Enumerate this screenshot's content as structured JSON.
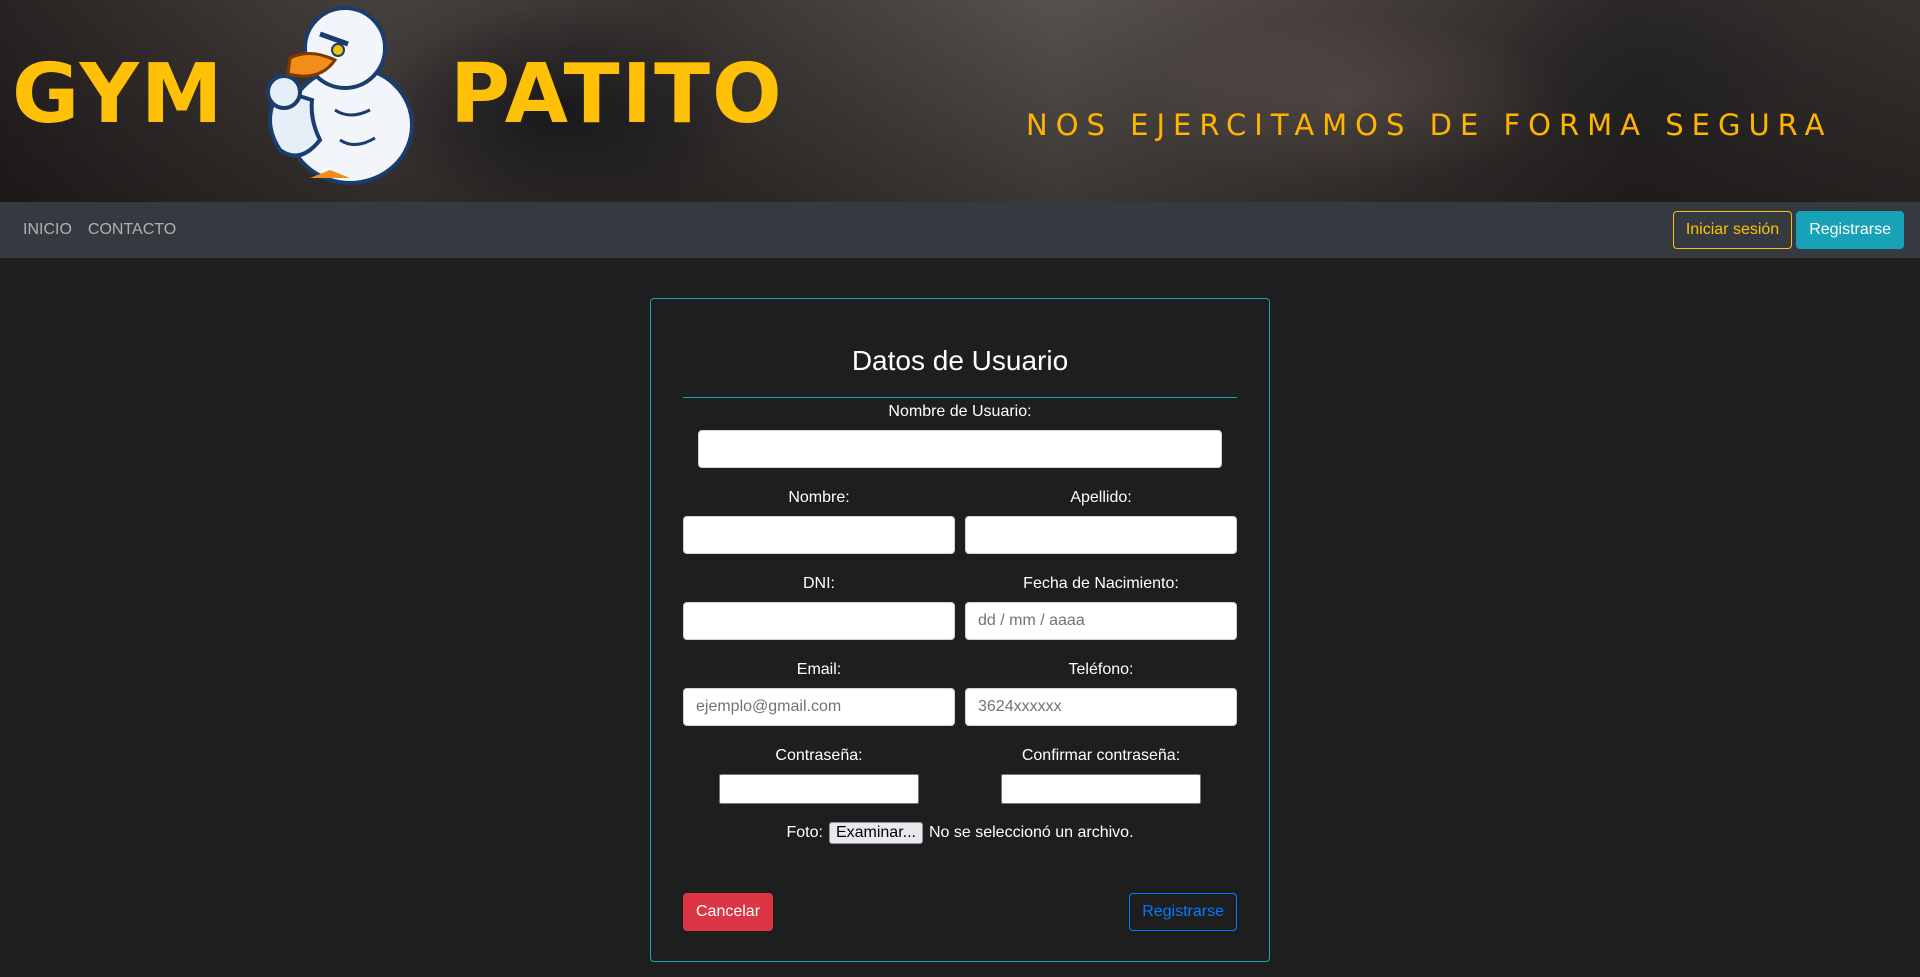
{
  "header": {
    "brand_left": "GYM",
    "brand_right": "PATITO",
    "logo_icon": "duck-mascot-icon",
    "slogan": "NOS EJERCITAMOS DE FORMA SEGURA"
  },
  "navbar": {
    "links": [
      {
        "label": "INICIO"
      },
      {
        "label": "CONTACTO"
      }
    ],
    "login_label": "Iniciar sesión",
    "register_label": "Registrarse"
  },
  "form": {
    "title": "Datos de Usuario",
    "username_label": "Nombre de Usuario:",
    "nombre_label": "Nombre:",
    "apellido_label": "Apellido:",
    "dni_label": "DNI:",
    "fecha_label": "Fecha de Nacimiento:",
    "fecha_placeholder": "dd / mm / aaaa",
    "email_label": "Email:",
    "email_placeholder": "ejemplo@gmail.com",
    "telefono_label": "Teléfono:",
    "telefono_placeholder": "3624xxxxxx",
    "password_label": "Contraseña:",
    "confirm_label": "Confirmar contraseña:",
    "foto_label": "Foto:",
    "file_button": "Examinar...",
    "file_status": "No se seleccionó un archivo.",
    "cancel_label": "Cancelar",
    "submit_label": "Registrarse"
  },
  "colors": {
    "brand": "#ffc107",
    "accent": "#17a2b8",
    "danger": "#dc3545",
    "primary": "#007bff",
    "background": "#1e1e1f",
    "navbar": "#343a40"
  }
}
